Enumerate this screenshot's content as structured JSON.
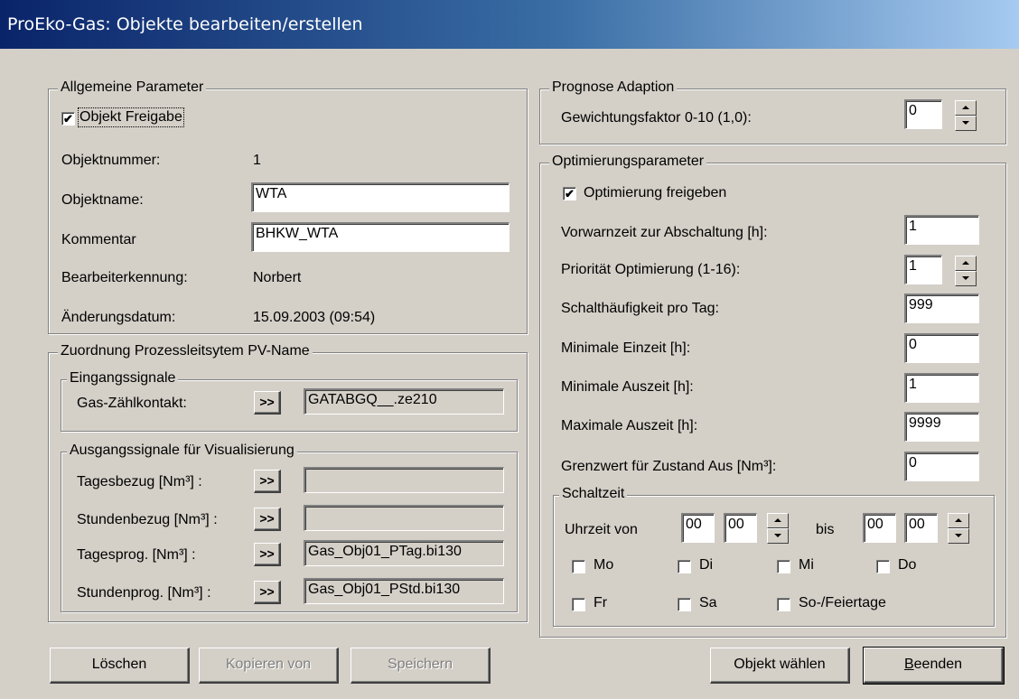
{
  "window": {
    "title": "ProEko-Gas: Objekte bearbeiten/erstellen"
  },
  "allgemein": {
    "legend": "Allgemeine Parameter",
    "freigabe_label": "Objekt Freigabe",
    "freigabe_checked": "✔",
    "objektnummer_label": "Objektnummer:",
    "objektnummer_value": "1",
    "objektname_label": "Objektname:",
    "objektname_value": "WTA",
    "kommentar_label": "Kommentar",
    "kommentar_value": "BHKW_WTA",
    "bearbeiter_label": "Bearbeiterkennung:",
    "bearbeiter_value": "Norbert",
    "datum_label": "Änderungsdatum:",
    "datum_value": "15.09.2003  (09:54)"
  },
  "zuordnung": {
    "legend": "Zuordnung Prozessleitsytem PV-Name",
    "eingang": {
      "legend": "Eingangssignale",
      "gas_label": "Gas-Zählkontakt:",
      "gas_value": "GATABGQ__.ze210"
    },
    "ausgang": {
      "legend": "Ausgangssignale für Visualisierung",
      "rows": [
        {
          "label": "Tagesbezug [Nm³] :",
          "value": ""
        },
        {
          "label": "Stundenbezug [Nm³] :",
          "value": ""
        },
        {
          "label": "Tagesprog. [Nm³] :",
          "value": "Gas_Obj01_PTag.bi130"
        },
        {
          "label": "Stundenprog. [Nm³] :",
          "value": "Gas_Obj01_PStd.bi130"
        }
      ]
    },
    "arrow_label": ">>"
  },
  "prognose": {
    "legend": "Prognose  Adaption",
    "gewicht_label": "Gewichtungsfaktor 0-10 (1,0):",
    "gewicht_value": "0"
  },
  "optimierung": {
    "legend": "Optimierungsparameter",
    "freigeben_label": "Optimierung freigeben",
    "freigeben_checked": "✔",
    "vorwarn_label": "Vorwarnzeit zur Abschaltung [h]:",
    "vorwarn_value": "1",
    "prioritaet_label": "Priorität Optimierung (1-16):",
    "prioritaet_value": "1",
    "schalt_label": "Schalthäufigkeit pro Tag:",
    "schalt_value": "999",
    "min_ein_label": "Minimale Einzeit  [h]:",
    "min_ein_value": "0",
    "min_aus_label": "Minimale Auszeit  [h]:",
    "min_aus_value": "1",
    "max_aus_label": "Maximale Auszeit [h]:",
    "max_aus_value": "9999",
    "grenz_label": "Grenzwert für Zustand Aus [Nm³]:",
    "grenz_value": "0",
    "schaltzeit": {
      "legend": "Schaltzeit",
      "von_label": "Uhrzeit von",
      "von_h": "00",
      "von_m": "00",
      "bis_label": "bis",
      "bis_h": "00",
      "bis_m": "00",
      "days": [
        "Mo",
        "Di",
        "Mi",
        "Do",
        "Fr",
        "Sa",
        "So-/Feiertage"
      ]
    }
  },
  "buttons": {
    "loeschen": "Löschen",
    "kopieren": "Kopieren von",
    "speichern": "Speichern",
    "objekt_waehlen": "Objekt wählen",
    "beenden_first": "B",
    "beenden_rest": "eenden"
  }
}
